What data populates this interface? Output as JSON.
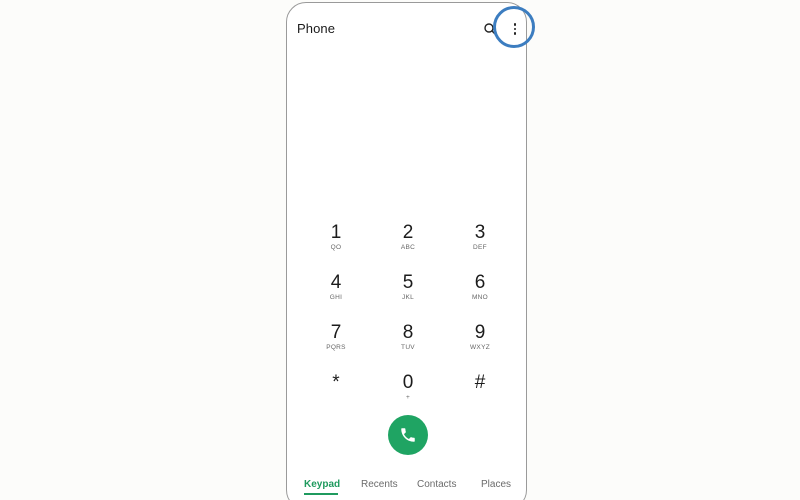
{
  "app": {
    "title": "Phone"
  },
  "toolbar": {
    "search_icon": "search-icon",
    "more_icon": "more-options-icon"
  },
  "keypad": {
    "keys": [
      {
        "digit": "1",
        "letters": "QO"
      },
      {
        "digit": "2",
        "letters": "ABC"
      },
      {
        "digit": "3",
        "letters": "DEF"
      },
      {
        "digit": "4",
        "letters": "GHI"
      },
      {
        "digit": "5",
        "letters": "JKL"
      },
      {
        "digit": "6",
        "letters": "MNO"
      },
      {
        "digit": "7",
        "letters": "PQRS"
      },
      {
        "digit": "8",
        "letters": "TUV"
      },
      {
        "digit": "9",
        "letters": "WXYZ"
      },
      {
        "digit": "*",
        "letters": ""
      },
      {
        "digit": "0",
        "letters": "+"
      },
      {
        "digit": "#",
        "letters": ""
      }
    ]
  },
  "call_button": {
    "icon": "phone-icon",
    "color": "#1fa463"
  },
  "tabs": {
    "items": [
      {
        "label": "Keypad",
        "active": true
      },
      {
        "label": "Recents",
        "active": false
      },
      {
        "label": "Contacts",
        "active": false
      },
      {
        "label": "Places",
        "active": false
      }
    ],
    "active_color": "#1f9a5e"
  },
  "annotation": {
    "ring_color": "#3c7dc0"
  }
}
